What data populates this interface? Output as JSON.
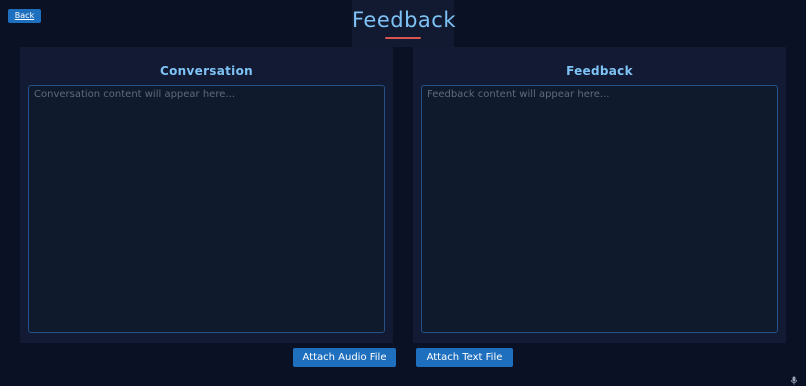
{
  "header": {
    "back_label": "Back",
    "title": "Feedback"
  },
  "panels": {
    "conversation": {
      "heading": "Conversation",
      "placeholder": "Conversation content will appear here..."
    },
    "feedback": {
      "heading": "Feedback",
      "placeholder": "Feedback content will appear here..."
    }
  },
  "actions": {
    "attach_audio": "Attach Audio File",
    "attach_text": "Attach Text File"
  },
  "icons": {
    "corner": "microphone-icon"
  },
  "colors": {
    "background": "#0b1124",
    "panel": "#121b33",
    "accent": "#7fc2f5",
    "button": "#1f6fbf",
    "underline": "#d9534f"
  }
}
